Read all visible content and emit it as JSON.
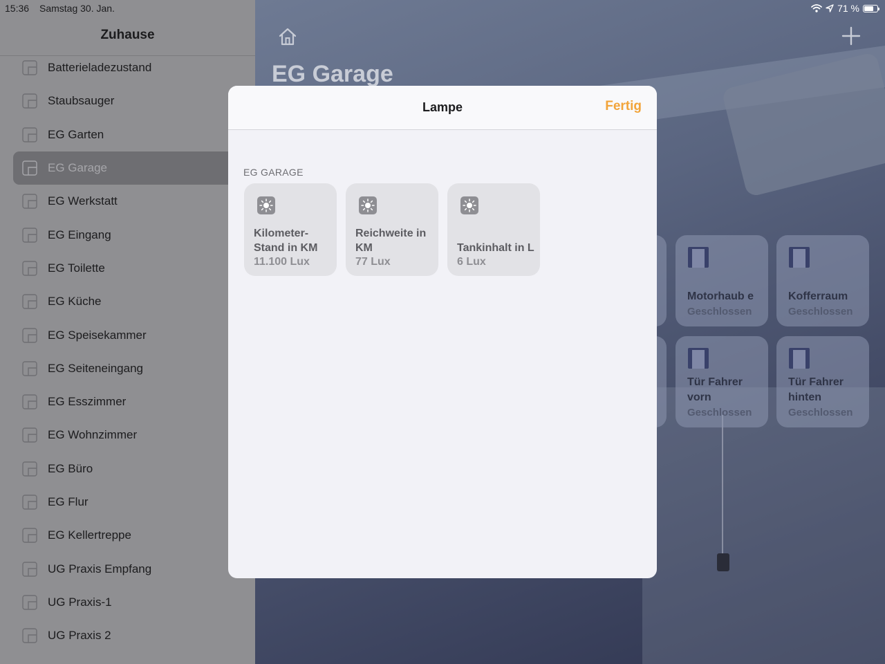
{
  "status_bar": {
    "time": "15:36",
    "date": "Samstag 30. Jan.",
    "battery_text": "71 %",
    "battery_level": 0.71
  },
  "sidebar": {
    "title": "Zuhause",
    "items": [
      {
        "label": "Batterieladezustand"
      },
      {
        "label": "Staubsauger"
      },
      {
        "label": "EG Garten"
      },
      {
        "label": "EG Garage",
        "selected": true
      },
      {
        "label": "EG Werkstatt"
      },
      {
        "label": "EG Eingang"
      },
      {
        "label": "EG Toilette"
      },
      {
        "label": "EG Küche"
      },
      {
        "label": "EG Speisekammer"
      },
      {
        "label": "EG Seiteneingang"
      },
      {
        "label": "EG Esszimmer"
      },
      {
        "label": "EG Wohnzimmer"
      },
      {
        "label": "EG Büro"
      },
      {
        "label": "EG Flur"
      },
      {
        "label": "EG Kellertreppe"
      },
      {
        "label": "UG Praxis Empfang"
      },
      {
        "label": "UG Praxis-1"
      },
      {
        "label": "UG Praxis 2"
      }
    ]
  },
  "main": {
    "title": "EG Garage",
    "accessories": [
      {
        "name": "Motorhaub e",
        "state": "Geschlossen"
      },
      {
        "name": "Kofferraum",
        "state": "Geschlossen"
      },
      {
        "name": "Tür Fahrer vorn",
        "state": "Geschlossen"
      },
      {
        "name": "Tür Fahrer hinten",
        "state": "Geschlossen"
      }
    ]
  },
  "modal": {
    "title": "Lampe",
    "done_label": "Fertig",
    "section_header": "EG GARAGE",
    "tiles": [
      {
        "name": "Kilometer-Stand in KM",
        "value": "11.100 Lux"
      },
      {
        "name": "Reichweite in KM",
        "value": "77 Lux"
      },
      {
        "name": "Tankinhalt in L",
        "value": "6 Lux"
      }
    ]
  },
  "colors": {
    "accent": "#f2a43a"
  }
}
